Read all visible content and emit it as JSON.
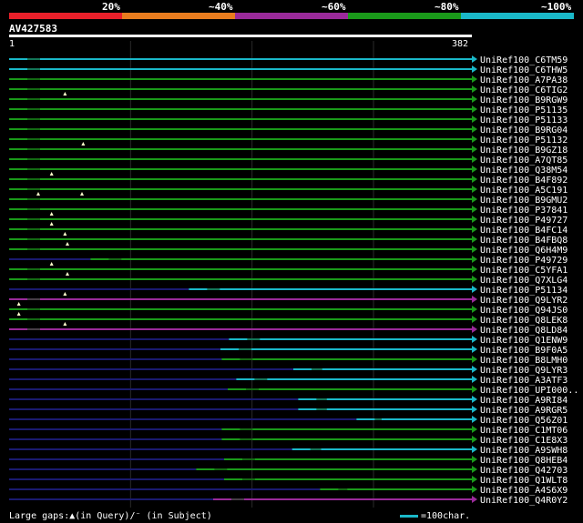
{
  "header": {
    "identity_labels": [
      "20%",
      "~40%",
      "~60%",
      "~80%",
      "~100%"
    ],
    "identity_colors": [
      "#e8202a",
      "#e87c1e",
      "#9a2a9a",
      "#1a9a1a",
      "#1ab8c8"
    ]
  },
  "query": {
    "name": "AV427583",
    "start_label": "1",
    "end_label": "382",
    "length": 382
  },
  "footer": {
    "gap_legend": "Large gaps:▲(in Query)/⁻ (in Subject)",
    "scale_legend": "=100char."
  },
  "colors": {
    "green": "#1a9a1a",
    "cyan": "#1ab8c8",
    "purple": "#9a2a9a",
    "navy": "#1a1a70",
    "dark_green": "#1a5a1a",
    "gap_marker": "#ffffcc"
  },
  "hits": [
    {
      "name": "UniRef100_C6TM59",
      "start": 1,
      "end": 382,
      "color": "cyan",
      "gap_marks": []
    },
    {
      "name": "UniRef100_C6THW5",
      "start": 1,
      "end": 382,
      "color": "cyan",
      "gap_marks": []
    },
    {
      "name": "UniRef100_A7PA38",
      "start": 1,
      "end": 382,
      "color": "green",
      "gap_marks": []
    },
    {
      "name": "UniRef100_C6TIG2",
      "start": 1,
      "end": 382,
      "color": "green",
      "gap_marks": []
    },
    {
      "name": "UniRef100_B9RGW9",
      "start": 1,
      "end": 382,
      "color": "green",
      "gap_marks": [
        47
      ]
    },
    {
      "name": "UniRef100_P51135",
      "start": 1,
      "end": 382,
      "color": "green",
      "gap_marks": []
    },
    {
      "name": "UniRef100_P51133",
      "start": 1,
      "end": 382,
      "color": "green",
      "gap_marks": []
    },
    {
      "name": "UniRef100_B9RG04",
      "start": 1,
      "end": 382,
      "color": "green",
      "gap_marks": []
    },
    {
      "name": "UniRef100_P51132",
      "start": 1,
      "end": 382,
      "color": "green",
      "gap_marks": []
    },
    {
      "name": "UniRef100_B9GZ18",
      "start": 1,
      "end": 382,
      "color": "green",
      "gap_marks": [
        62
      ]
    },
    {
      "name": "UniRef100_A7QT85",
      "start": 1,
      "end": 382,
      "color": "green",
      "gap_marks": []
    },
    {
      "name": "UniRef100_Q38M54",
      "start": 1,
      "end": 382,
      "color": "green",
      "gap_marks": []
    },
    {
      "name": "UniRef100_B4F892",
      "start": 1,
      "end": 382,
      "color": "green",
      "gap_marks": [
        36
      ]
    },
    {
      "name": "UniRef100_A5C191",
      "start": 1,
      "end": 382,
      "color": "green",
      "gap_marks": []
    },
    {
      "name": "UniRef100_B9GMU2",
      "start": 1,
      "end": 382,
      "color": "green",
      "gap_marks": [
        25,
        61
      ]
    },
    {
      "name": "UniRef100_P37841",
      "start": 1,
      "end": 382,
      "color": "green",
      "gap_marks": []
    },
    {
      "name": "UniRef100_P49727",
      "start": 1,
      "end": 382,
      "color": "green",
      "gap_marks": [
        36
      ]
    },
    {
      "name": "UniRef100_B4FC14",
      "start": 1,
      "end": 382,
      "color": "green",
      "gap_marks": [
        36
      ]
    },
    {
      "name": "UniRef100_B4FBQ8",
      "start": 1,
      "end": 382,
      "color": "green",
      "gap_marks": [
        47
      ]
    },
    {
      "name": "UniRef100_Q6H4M9",
      "start": 1,
      "end": 382,
      "color": "green",
      "gap_marks": [
        49
      ]
    },
    {
      "name": "UniRef100_P49729",
      "start": 68,
      "end": 382,
      "color": "green",
      "gap_marks": []
    },
    {
      "name": "UniRef100_C5YFA1",
      "start": 1,
      "end": 382,
      "color": "green",
      "gap_marks": [
        36
      ]
    },
    {
      "name": "UniRef100_Q7XLG4",
      "start": 1,
      "end": 382,
      "color": "green",
      "gap_marks": [
        49
      ]
    },
    {
      "name": "UniRef100_P51134",
      "start": 149,
      "end": 382,
      "color": "cyan",
      "gap_marks": []
    },
    {
      "name": "UniRef100_Q9LYR2",
      "start": 1,
      "end": 382,
      "color": "purple",
      "gap_marks": [
        47
      ]
    },
    {
      "name": "UniRef100_Q94JS0",
      "start": 1,
      "end": 382,
      "color": "green",
      "gap_marks": [
        9
      ]
    },
    {
      "name": "UniRef100_Q8LEK8",
      "start": 1,
      "end": 382,
      "color": "green",
      "gap_marks": [
        9
      ]
    },
    {
      "name": "UniRef100_Q8LD84",
      "start": 1,
      "end": 382,
      "color": "purple",
      "gap_marks": [
        47
      ]
    },
    {
      "name": "UniRef100_Q1ENW9",
      "start": 182,
      "end": 382,
      "color": "cyan",
      "gap_marks": []
    },
    {
      "name": "UniRef100_B9F0A5",
      "start": 175,
      "end": 382,
      "color": "cyan",
      "gap_marks": []
    },
    {
      "name": "UniRef100_B8LMH0",
      "start": 176,
      "end": 382,
      "color": "green",
      "gap_marks": []
    },
    {
      "name": "UniRef100_Q9LYR3",
      "start": 235,
      "end": 382,
      "color": "cyan",
      "gap_marks": []
    },
    {
      "name": "UniRef100_A3ATF3",
      "start": 188,
      "end": 382,
      "color": "cyan",
      "gap_marks": []
    },
    {
      "name": "UniRef100_UPI000..",
      "start": 181,
      "end": 382,
      "color": "green",
      "gap_marks": []
    },
    {
      "name": "UniRef100_A9RI84",
      "start": 239,
      "end": 382,
      "color": "cyan",
      "gap_marks": []
    },
    {
      "name": "UniRef100_A9RGR5",
      "start": 239,
      "end": 382,
      "color": "cyan",
      "gap_marks": []
    },
    {
      "name": "UniRef100_Q56Z01",
      "start": 287,
      "end": 382,
      "color": "cyan",
      "gap_marks": []
    },
    {
      "name": "UniRef100_C1MT06",
      "start": 176,
      "end": 382,
      "color": "green",
      "gap_marks": []
    },
    {
      "name": "UniRef100_C1E8X3",
      "start": 176,
      "end": 382,
      "color": "green",
      "gap_marks": []
    },
    {
      "name": "UniRef100_A9SWH8",
      "start": 234,
      "end": 382,
      "color": "cyan",
      "gap_marks": []
    },
    {
      "name": "UniRef100_Q8HEB4",
      "start": 178,
      "end": 382,
      "color": "green",
      "gap_marks": []
    },
    {
      "name": "UniRef100_Q42703",
      "start": 155,
      "end": 382,
      "color": "green",
      "gap_marks": []
    },
    {
      "name": "UniRef100_Q1WLT8",
      "start": 178,
      "end": 382,
      "color": "green",
      "gap_marks": []
    },
    {
      "name": "UniRef100_A4S6X9",
      "start": 257,
      "end": 382,
      "color": "green",
      "gap_marks": []
    },
    {
      "name": "UniRef100_Q4R0Y2",
      "start": 169,
      "end": 382,
      "color": "purple",
      "gap_marks": []
    }
  ]
}
